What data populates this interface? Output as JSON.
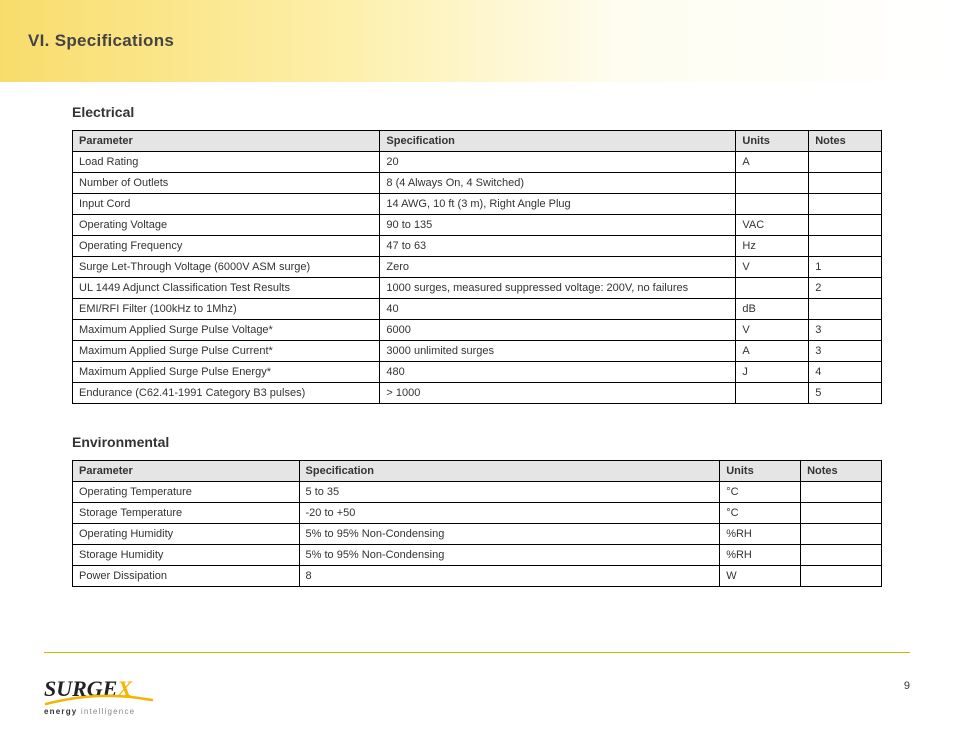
{
  "header": {
    "title": "VI. Specifications",
    "page_number": "9"
  },
  "general": {
    "section_title": "Electrical",
    "columns": [
      "Parameter",
      "Specification",
      "Units",
      "Notes"
    ],
    "rows": [
      {
        "p": "Load Rating",
        "s": "20",
        "u": "A",
        "n": ""
      },
      {
        "p": "Number of Outlets",
        "s": "8 (4 Always On, 4 Switched)",
        "u": "",
        "n": ""
      },
      {
        "p": "Input Cord",
        "s": "14 AWG, 10 ft (3 m), Right Angle Plug",
        "u": "",
        "n": ""
      },
      {
        "p": "Operating Voltage",
        "s": "90 to 135",
        "u": "VAC",
        "n": ""
      },
      {
        "p": "Operating Frequency",
        "s": "47 to 63",
        "u": "Hz",
        "n": ""
      },
      {
        "p": "Surge Let-Through Voltage (6000V ASM surge)",
        "s": "Zero",
        "u": "V",
        "n": "1"
      },
      {
        "p": "UL 1449 Adjunct Classification Test Results",
        "s": "1000 surges, measured suppressed voltage: 200V, no failures",
        "u": "",
        "n": "2"
      },
      {
        "p": "EMI/RFI Filter (100kHz to 1Mhz)",
        "s": "40",
        "u": "dB",
        "n": ""
      },
      {
        "p": "Maximum Applied Surge Pulse Voltage*",
        "s": "6000",
        "u": "V",
        "n": "3"
      },
      {
        "p": "Maximum Applied Surge Pulse Current*",
        "s": "3000 unlimited surges",
        "u": "A",
        "n": "3"
      },
      {
        "p": "Maximum Applied Surge Pulse Energy*",
        "s": "480",
        "u": "J",
        "n": "4"
      },
      {
        "p": "Endurance (C62.41-1991 Category B3 pulses)",
        "s": "> 1000",
        "u": "",
        "n": "5"
      }
    ]
  },
  "env": {
    "section_title": "Environmental",
    "columns": [
      "Parameter",
      "Specification",
      "Units",
      "Notes"
    ],
    "rows": [
      {
        "p": "Operating Temperature",
        "s": "5 to 35",
        "u": "°C",
        "n": ""
      },
      {
        "p": "Storage Temperature",
        "s": "-20 to +50",
        "u": "°C",
        "n": ""
      },
      {
        "p": "Operating Humidity",
        "s": "5% to 95% Non-Condensing",
        "u": "%RH",
        "n": ""
      },
      {
        "p": "Storage Humidity",
        "s": "5% to 95% Non-Condensing",
        "u": "%RH",
        "n": ""
      },
      {
        "p": "Power Dissipation",
        "s": "8",
        "u": "W",
        "n": ""
      }
    ]
  },
  "brand": {
    "name_plain": "SURGE",
    "name_accent": "X",
    "tagline_dark": "energy",
    "tagline_light": "intelligence"
  }
}
